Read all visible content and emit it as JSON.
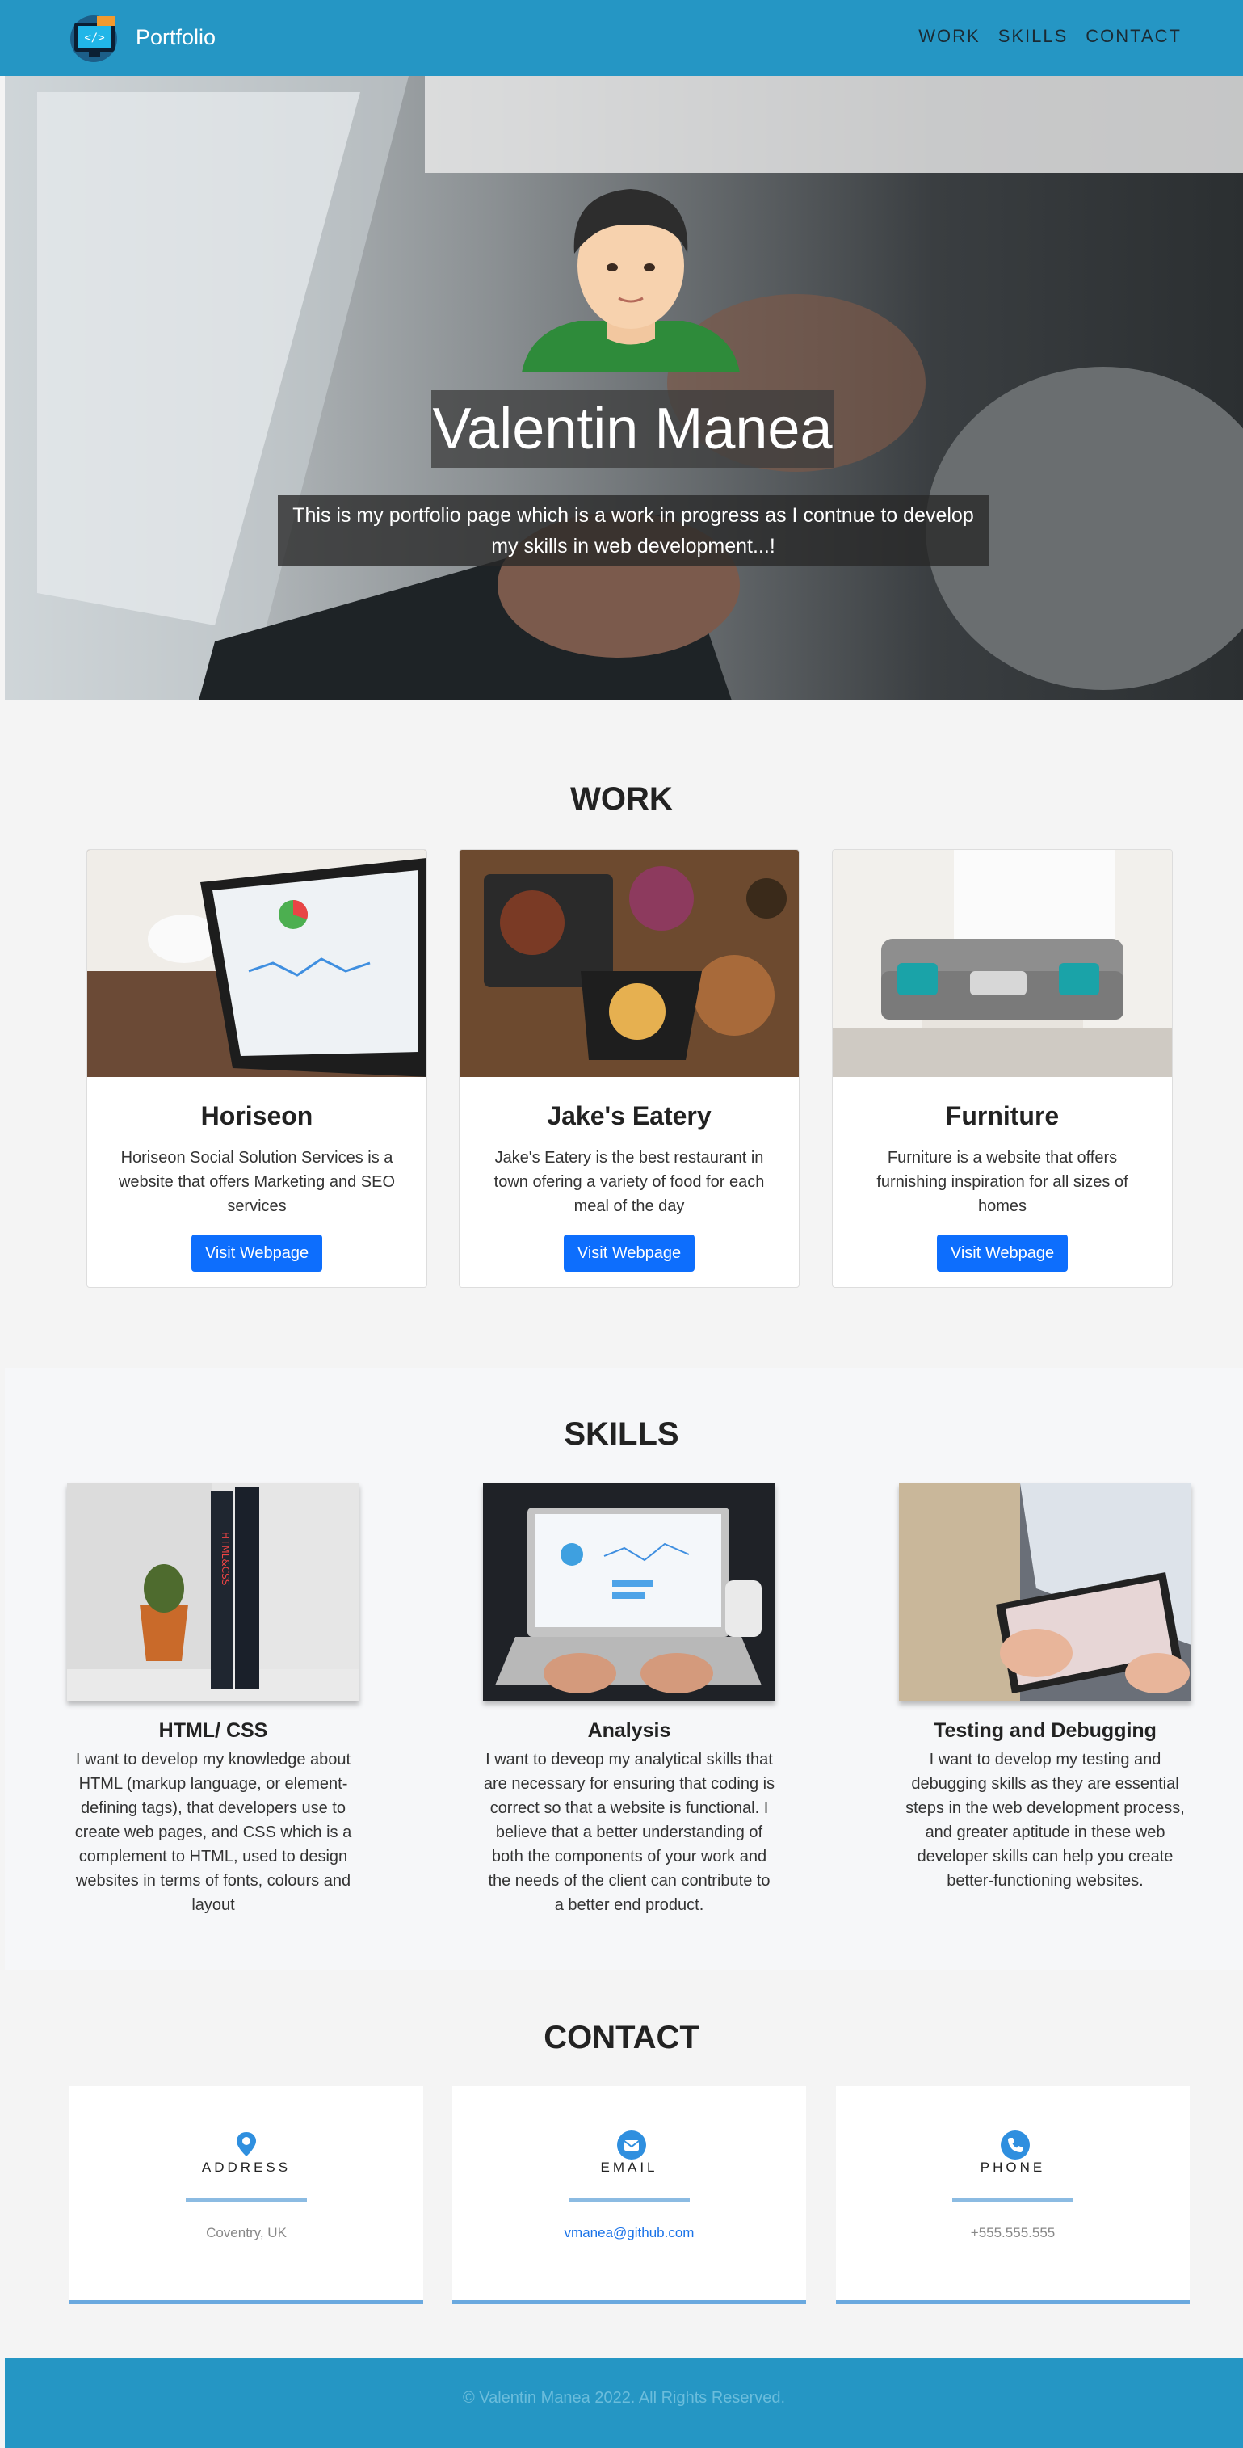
{
  "nav": {
    "brand": "Portfolio",
    "links": [
      "WORK",
      "SKILLS",
      "CONTACT"
    ]
  },
  "hero": {
    "name": "Valentin Manea",
    "tagline": "This is my portfolio page which is a work in progress as I contnue to develop my skills in web development...!"
  },
  "work": {
    "title": "WORK",
    "cards": [
      {
        "title": "Horiseon",
        "desc": "Horiseon Social Solution Services is a website that offers Marketing and SEO services",
        "button": "Visit Webpage"
      },
      {
        "title": "Jake's Eatery",
        "desc": "Jake's Eatery is the best restaurant in town ofering a variety of food for each meal of the day",
        "button": "Visit Webpage"
      },
      {
        "title": "Furniture",
        "desc": "Furniture is a website that offers furnishing inspiration for all sizes of homes",
        "button": "Visit Webpage"
      }
    ]
  },
  "skills": {
    "title": "SKILLS",
    "items": [
      {
        "title": "HTML/ CSS",
        "desc": "I want to develop my knowledge about HTML (markup language, or element-defining tags), that developers use to create web pages, and CSS which is a complement to HTML, used to design websites in terms of fonts, colours and layout"
      },
      {
        "title": "Analysis",
        "desc": "I want to deveop my analytical skills that are necessary for ensuring that coding is correct so that a website is functional. I believe that a better understanding of both the components of your work and the needs of the client can contribute to a better end product."
      },
      {
        "title": "Testing and Debugging",
        "desc": "I want to develop my testing and debugging skills as they are essential steps in the web development process, and greater aptitude in these web developer skills can help you create better-functioning websites."
      }
    ]
  },
  "contact": {
    "title": "CONTACT",
    "cards": [
      {
        "label": "ADDRESS",
        "value": "Coventry, UK",
        "icon": "map-pin-icon"
      },
      {
        "label": "EMAIL",
        "value": "vmanea@github.com",
        "icon": "envelope-icon"
      },
      {
        "label": "PHONE",
        "value": "+555.555.555",
        "icon": "phone-icon"
      }
    ]
  },
  "footer": {
    "text": "© Valentin Manea 2022. All Rights Reserved."
  },
  "colors": {
    "primary": "#2596c4",
    "button": "#0d6efd",
    "accent_rule": "#6aa9df"
  }
}
